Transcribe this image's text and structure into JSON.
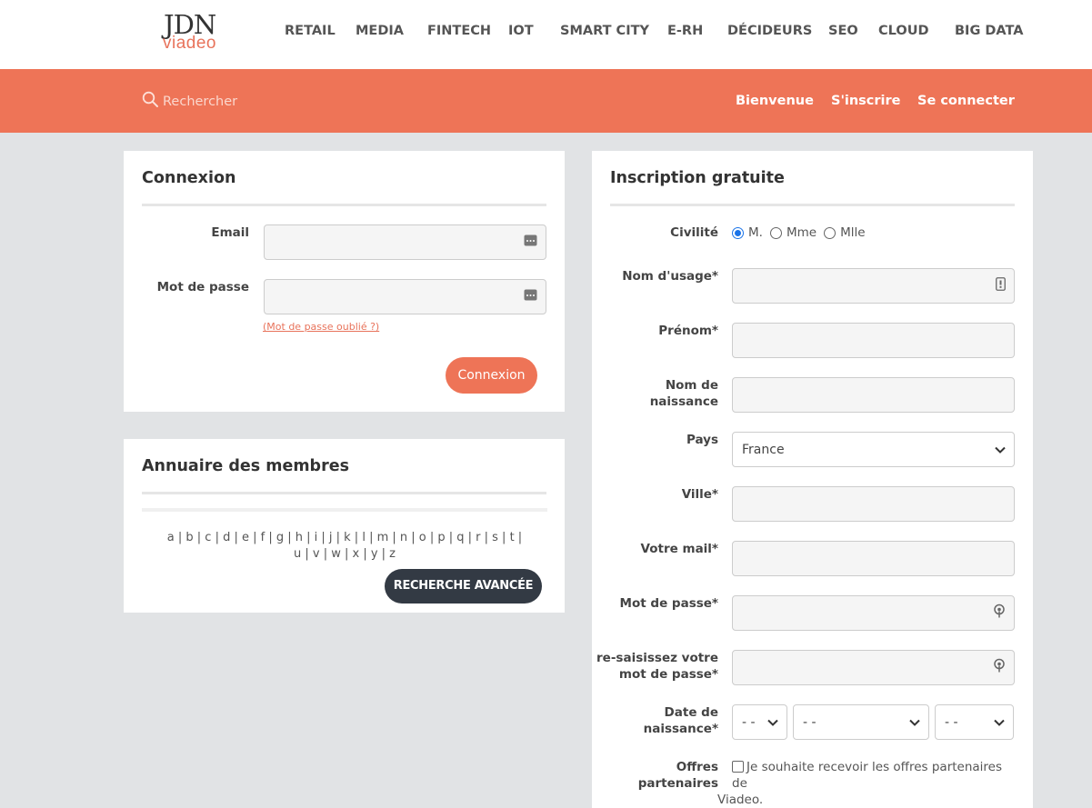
{
  "brand": {
    "logo_top": "JDN",
    "logo_bottom": "viadeo"
  },
  "nav": [
    "RETAIL",
    "MEDIA",
    "FINTECH",
    "IOT",
    "SMART CITY",
    "E-RH",
    "DÉCIDEURS",
    "SEO",
    "CLOUD",
    "BIG DATA"
  ],
  "search": {
    "placeholder": "Rechercher"
  },
  "top_links": {
    "welcome": "Bienvenue",
    "signup": "S'inscrire",
    "login": "Se connecter"
  },
  "login": {
    "title": "Connexion",
    "email_label": "Email",
    "password_label": "Mot de passe",
    "forgot": "(Mot de passe oublié ?)",
    "button": "Connexion"
  },
  "directory": {
    "title": "Annuaire des membres",
    "alphabet": "a | b | c | d | e | f | g | h | i | j | k | l | m | n | o | p | q | r | s | t | u | v | w | x | y | z",
    "button": "RECHERCHE AVANCÉE"
  },
  "signup": {
    "title": "Inscription gratuite",
    "civility_label": "Civilité",
    "civility_options": [
      "M.",
      "Mme",
      "Mlle"
    ],
    "civility_selected": "M.",
    "usage_name_label": "Nom d'usage*",
    "first_name_label": "Prénom*",
    "birth_name_label_1": "Nom de",
    "birth_name_label_2": "naissance",
    "country_label": "Pays",
    "country_value": "France",
    "city_label": "Ville*",
    "email_label": "Votre mail*",
    "password_label": "Mot de passe*",
    "password2_label_1": "re-saisissez votre",
    "password2_label_2": "mot de passe*",
    "birthdate_label_1": "Date de",
    "birthdate_label_2": "naissance*",
    "birth_day": "- -",
    "birth_month": "- -",
    "birth_year": "- -",
    "offers_label_1": "Offres",
    "offers_label_2": "partenaires",
    "offers_text_1": "Je souhaite recevoir les offres partenaires de",
    "offers_text_2": "Viadeo."
  },
  "colors": {
    "accent": "#ee7457",
    "dark_button": "#333a44",
    "background": "#e1e3e5"
  }
}
